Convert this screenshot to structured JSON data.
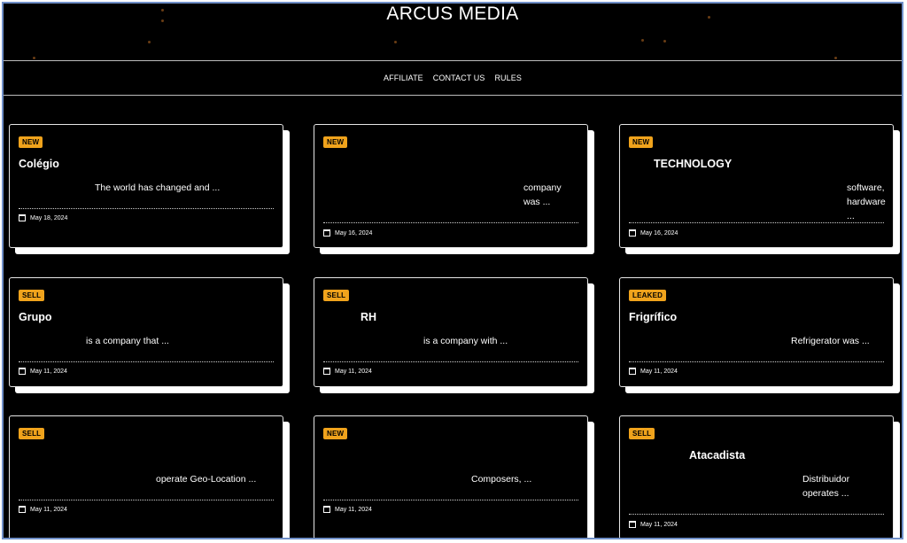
{
  "site": {
    "title": "ARCUS MEDIA"
  },
  "nav": {
    "items": [
      "AFFILIATE",
      "CONTACT US",
      "RULES"
    ]
  },
  "cards": [
    {
      "badge": "NEW",
      "title": "Colégio",
      "excerpt": "The world has changed and ...",
      "date": "May 18, 2024"
    },
    {
      "badge": "NEW",
      "title": "",
      "excerpt": "company was ...",
      "date": "May 16, 2024"
    },
    {
      "badge": "NEW",
      "title": "TECHNOLOGY",
      "excerpt": "software, hardware ...",
      "date": "May 16, 2024"
    },
    {
      "badge": "SELL",
      "title": "Grupo",
      "excerpt": "is a company that ...",
      "date": "May 11, 2024"
    },
    {
      "badge": "SELL",
      "title": "RH",
      "excerpt": "is a company with ...",
      "date": "May 11, 2024"
    },
    {
      "badge": "LEAKED",
      "title": "Frigrífico",
      "excerpt": "Refrigerator was ...",
      "date": "May 11, 2024"
    },
    {
      "badge": "SELL",
      "title": "",
      "excerpt": "operate Geo-Location ...",
      "date": "May 11, 2024"
    },
    {
      "badge": "NEW",
      "title": "",
      "excerpt": "Composers, ...",
      "date": "May 11, 2024"
    },
    {
      "badge": "SELL",
      "title": "Atacadista",
      "excerpt": "Distribuidor operates ...",
      "date": "May 11, 2024"
    }
  ]
}
